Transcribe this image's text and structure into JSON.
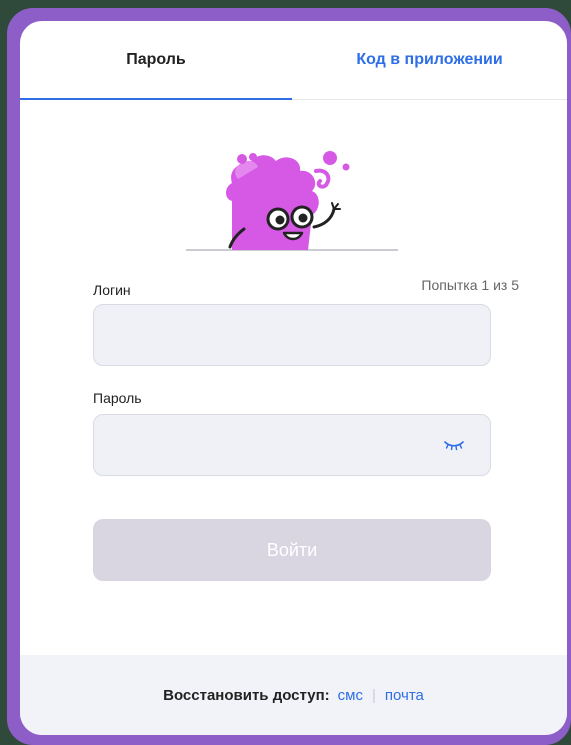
{
  "tabs": [
    {
      "label": "Пароль"
    },
    {
      "label": "Код в приложении"
    }
  ],
  "form": {
    "login_label": "Логин",
    "attempt_text": "Попытка 1 из 5",
    "password_label": "Пароль",
    "login_value": "",
    "password_value": "",
    "submit_label": "Войти"
  },
  "footer": {
    "restore_label": "Восстановить доступ:",
    "sms_link": "смс",
    "separator": "|",
    "email_link": "почта"
  },
  "colors": {
    "accent": "#2e6ee6",
    "frame": "#8e5ec8",
    "mascot": "#d659e6",
    "disabled_button": "#d9d5e1"
  },
  "icons": {
    "password_visibility": "eye-closed-icon",
    "mascot": "mascot-illustration"
  }
}
